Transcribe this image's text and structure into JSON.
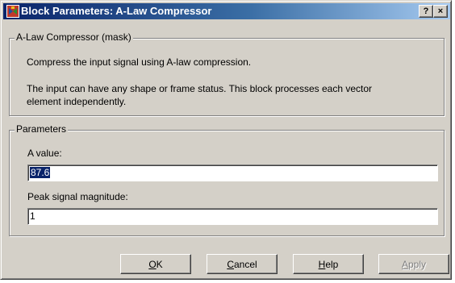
{
  "window": {
    "title": "Block Parameters: A-Law Compressor",
    "help_glyph": "?",
    "close_glyph": "×"
  },
  "description": {
    "legend": "A-Law Compressor (mask)",
    "line1": "Compress the input signal using A-law compression.",
    "line2": "The input can have any shape or frame status. This block processes each vector",
    "line3": "element independently."
  },
  "parameters": {
    "legend": "Parameters",
    "a_value_label": "A value:",
    "a_value": "87.6",
    "peak_label": "Peak signal magnitude:",
    "peak_value": "1"
  },
  "buttons": {
    "ok_mnemonic": "O",
    "ok_rest": "K",
    "cancel_mnemonic": "C",
    "cancel_rest": "ancel",
    "help_mnemonic": "H",
    "help_rest": "elp",
    "apply_mnemonic": "A",
    "apply_rest": "pply"
  },
  "colors": {
    "titlebar_start": "#0a246a",
    "titlebar_end": "#a6caf0",
    "face": "#d4d0c8",
    "selection": "#0a246a"
  },
  "icons": {
    "title_icon": "simulink-block-icon"
  }
}
